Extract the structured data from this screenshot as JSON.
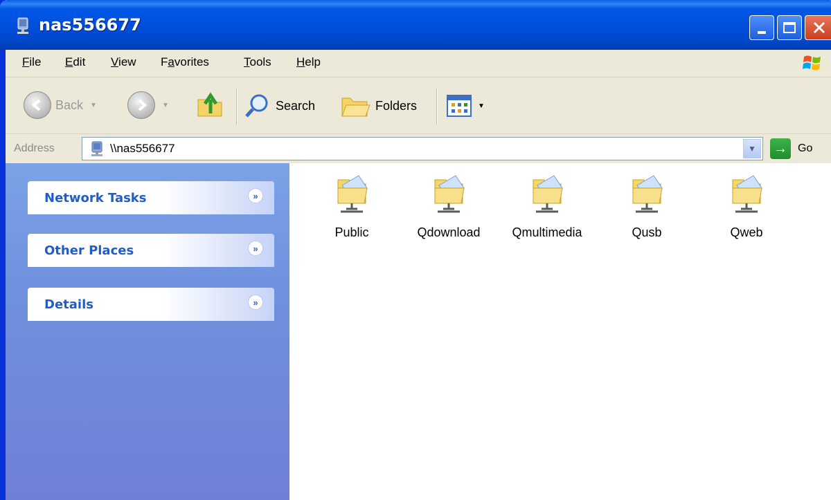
{
  "window": {
    "title": "nas556677"
  },
  "menu": [
    {
      "label": "File",
      "accel": "F",
      "rest": "ile"
    },
    {
      "label": "Edit",
      "accel": "E",
      "rest": "dit"
    },
    {
      "label": "View",
      "accel": "V",
      "rest": "iew"
    },
    {
      "label": "Favorites",
      "pre": "F",
      "accel": "a",
      "rest": "vorites"
    },
    {
      "label": "Tools",
      "accel": "T",
      "rest": "ools"
    },
    {
      "label": "Help",
      "accel": "H",
      "rest": "elp"
    }
  ],
  "toolbar": {
    "back_label": "Back",
    "search_label": "Search",
    "folders_label": "Folders"
  },
  "address": {
    "label": "Address",
    "value": "\\\\nas556677",
    "go_label": "Go"
  },
  "taskpane": {
    "sections": [
      {
        "title": "Network Tasks"
      },
      {
        "title": "Other Places"
      },
      {
        "title": "Details"
      }
    ]
  },
  "shares": [
    {
      "name": "Public",
      "icon": "shared-folder-icon"
    },
    {
      "name": "Qdownload",
      "icon": "shared-folder-icon"
    },
    {
      "name": "Qmultimedia",
      "icon": "shared-folder-icon"
    },
    {
      "name": "Qusb",
      "icon": "shared-folder-icon"
    },
    {
      "name": "Qweb",
      "icon": "shared-folder-icon"
    }
  ]
}
